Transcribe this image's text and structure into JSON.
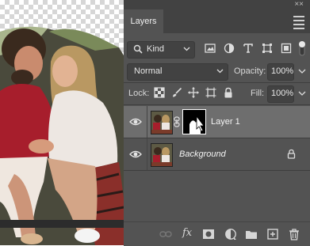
{
  "panel": {
    "tab_label": "Layers",
    "close_glyph": "××"
  },
  "filter": {
    "kind_label": "Kind",
    "icons": [
      "image-filter-icon",
      "adjustment-filter-icon",
      "type-filter-icon",
      "shape-filter-icon",
      "smart-object-filter-icon",
      "filter-toggle-icon"
    ]
  },
  "blend": {
    "mode": "Normal",
    "opacity_label": "Opacity:",
    "opacity_value": "100%"
  },
  "lock": {
    "label": "Lock:",
    "icons": [
      "lock-transparent-pixels-icon",
      "lock-image-pixels-icon",
      "lock-position-icon",
      "lock-artboard-icon",
      "lock-all-icon"
    ],
    "fill_label": "Fill:",
    "fill_value": "100%"
  },
  "layers": [
    {
      "name": "Layer 1",
      "selected": true,
      "visible": true,
      "has_mask": true
    },
    {
      "name": "Background",
      "selected": false,
      "visible": true,
      "locked": true
    }
  ],
  "bottom_icons": [
    "link-layers-icon",
    "fx-icon",
    "add-mask-icon",
    "adjustment-layer-icon",
    "new-group-icon",
    "new-layer-icon",
    "delete-layer-icon"
  ],
  "fx_label": "fx",
  "colors": {
    "panel_bg": "#535353",
    "tab_bar_bg": "#424242",
    "selected_row_bg": "#6e6e6e"
  }
}
